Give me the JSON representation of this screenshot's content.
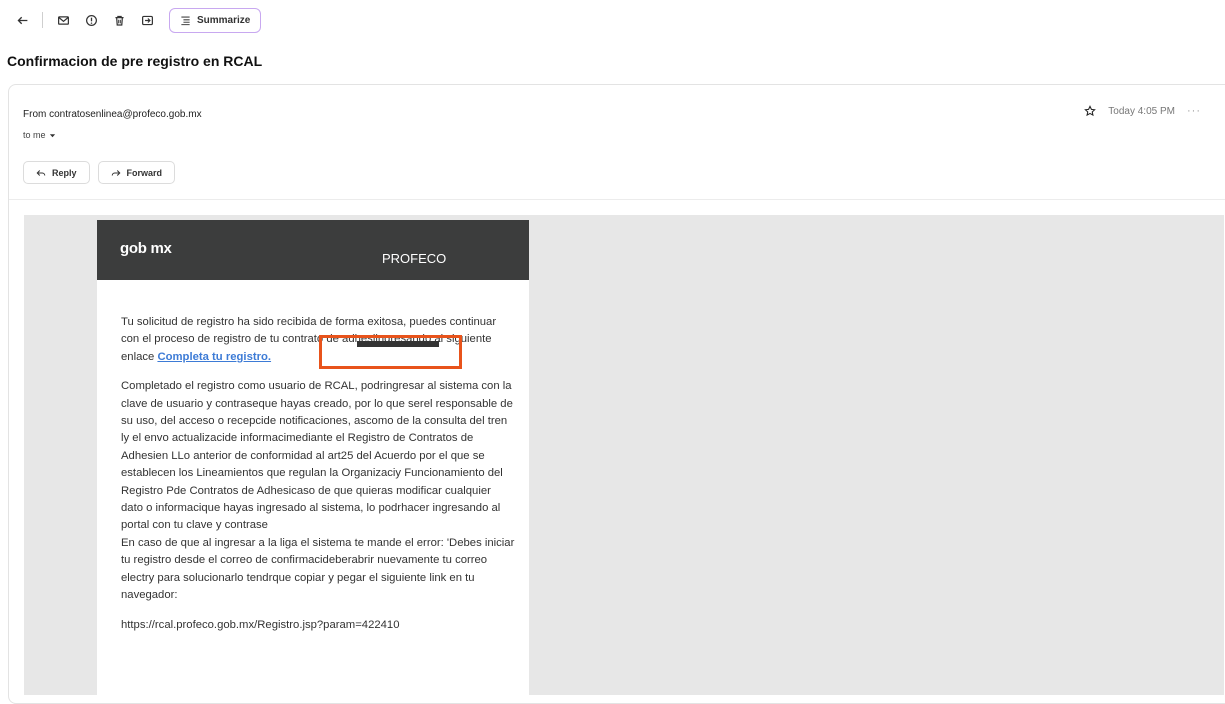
{
  "toolbar": {
    "summarize_label": "Summarize"
  },
  "message": {
    "subject": "Confirmacion de pre registro en RCAL",
    "from_line": "From contratosenlinea@profeco.gob.mx",
    "to_line": "to me",
    "time": "Today 4:05 PM",
    "more": "···",
    "reply_label": "Reply",
    "forward_label": "Forward"
  },
  "email": {
    "logo": "gob mx",
    "agency": "PROFECO",
    "para1_text": "Tu solicitud de registro ha sido recibida de forma exitosa, puedes continuar con el proceso de registro de tu contrato de adhesiingresando al siguiente enlace ",
    "link_text": "Completa tu registro.",
    "para2": "Completado el registro como usuario de RCAL, podringresar al sistema con la clave de usuario y contraseque hayas creado, por lo que serel responsable de su uso, del acceso o recepcide notificaciones, ascomo de la consulta del tren ly el envo actualizacide informacimediante el Registro de Contratos de Adhesien LLo anterior de conformidad al art25 del Acuerdo por el que se establecen los Lineamientos que regulan la Organizaciy Funcionamiento del Registro Pde Contratos de Adhesicaso de que quieras modificar cualquier dato o informacique hayas ingresado al sistema, lo podrhacer ingresando al portal con tu clave y contrase",
    "para3": "En caso de que al ingresar a la liga el sistema te mande el error: 'Debes iniciar tu registro desde el correo de confirmacideberabrir nuevamente tu correo electry para solucionarlo tendrque copiar y pegar el siguiente link en tu navegador:",
    "url": "https://rcal.profeco.gob.mx/Registro.jsp?param=422410"
  }
}
